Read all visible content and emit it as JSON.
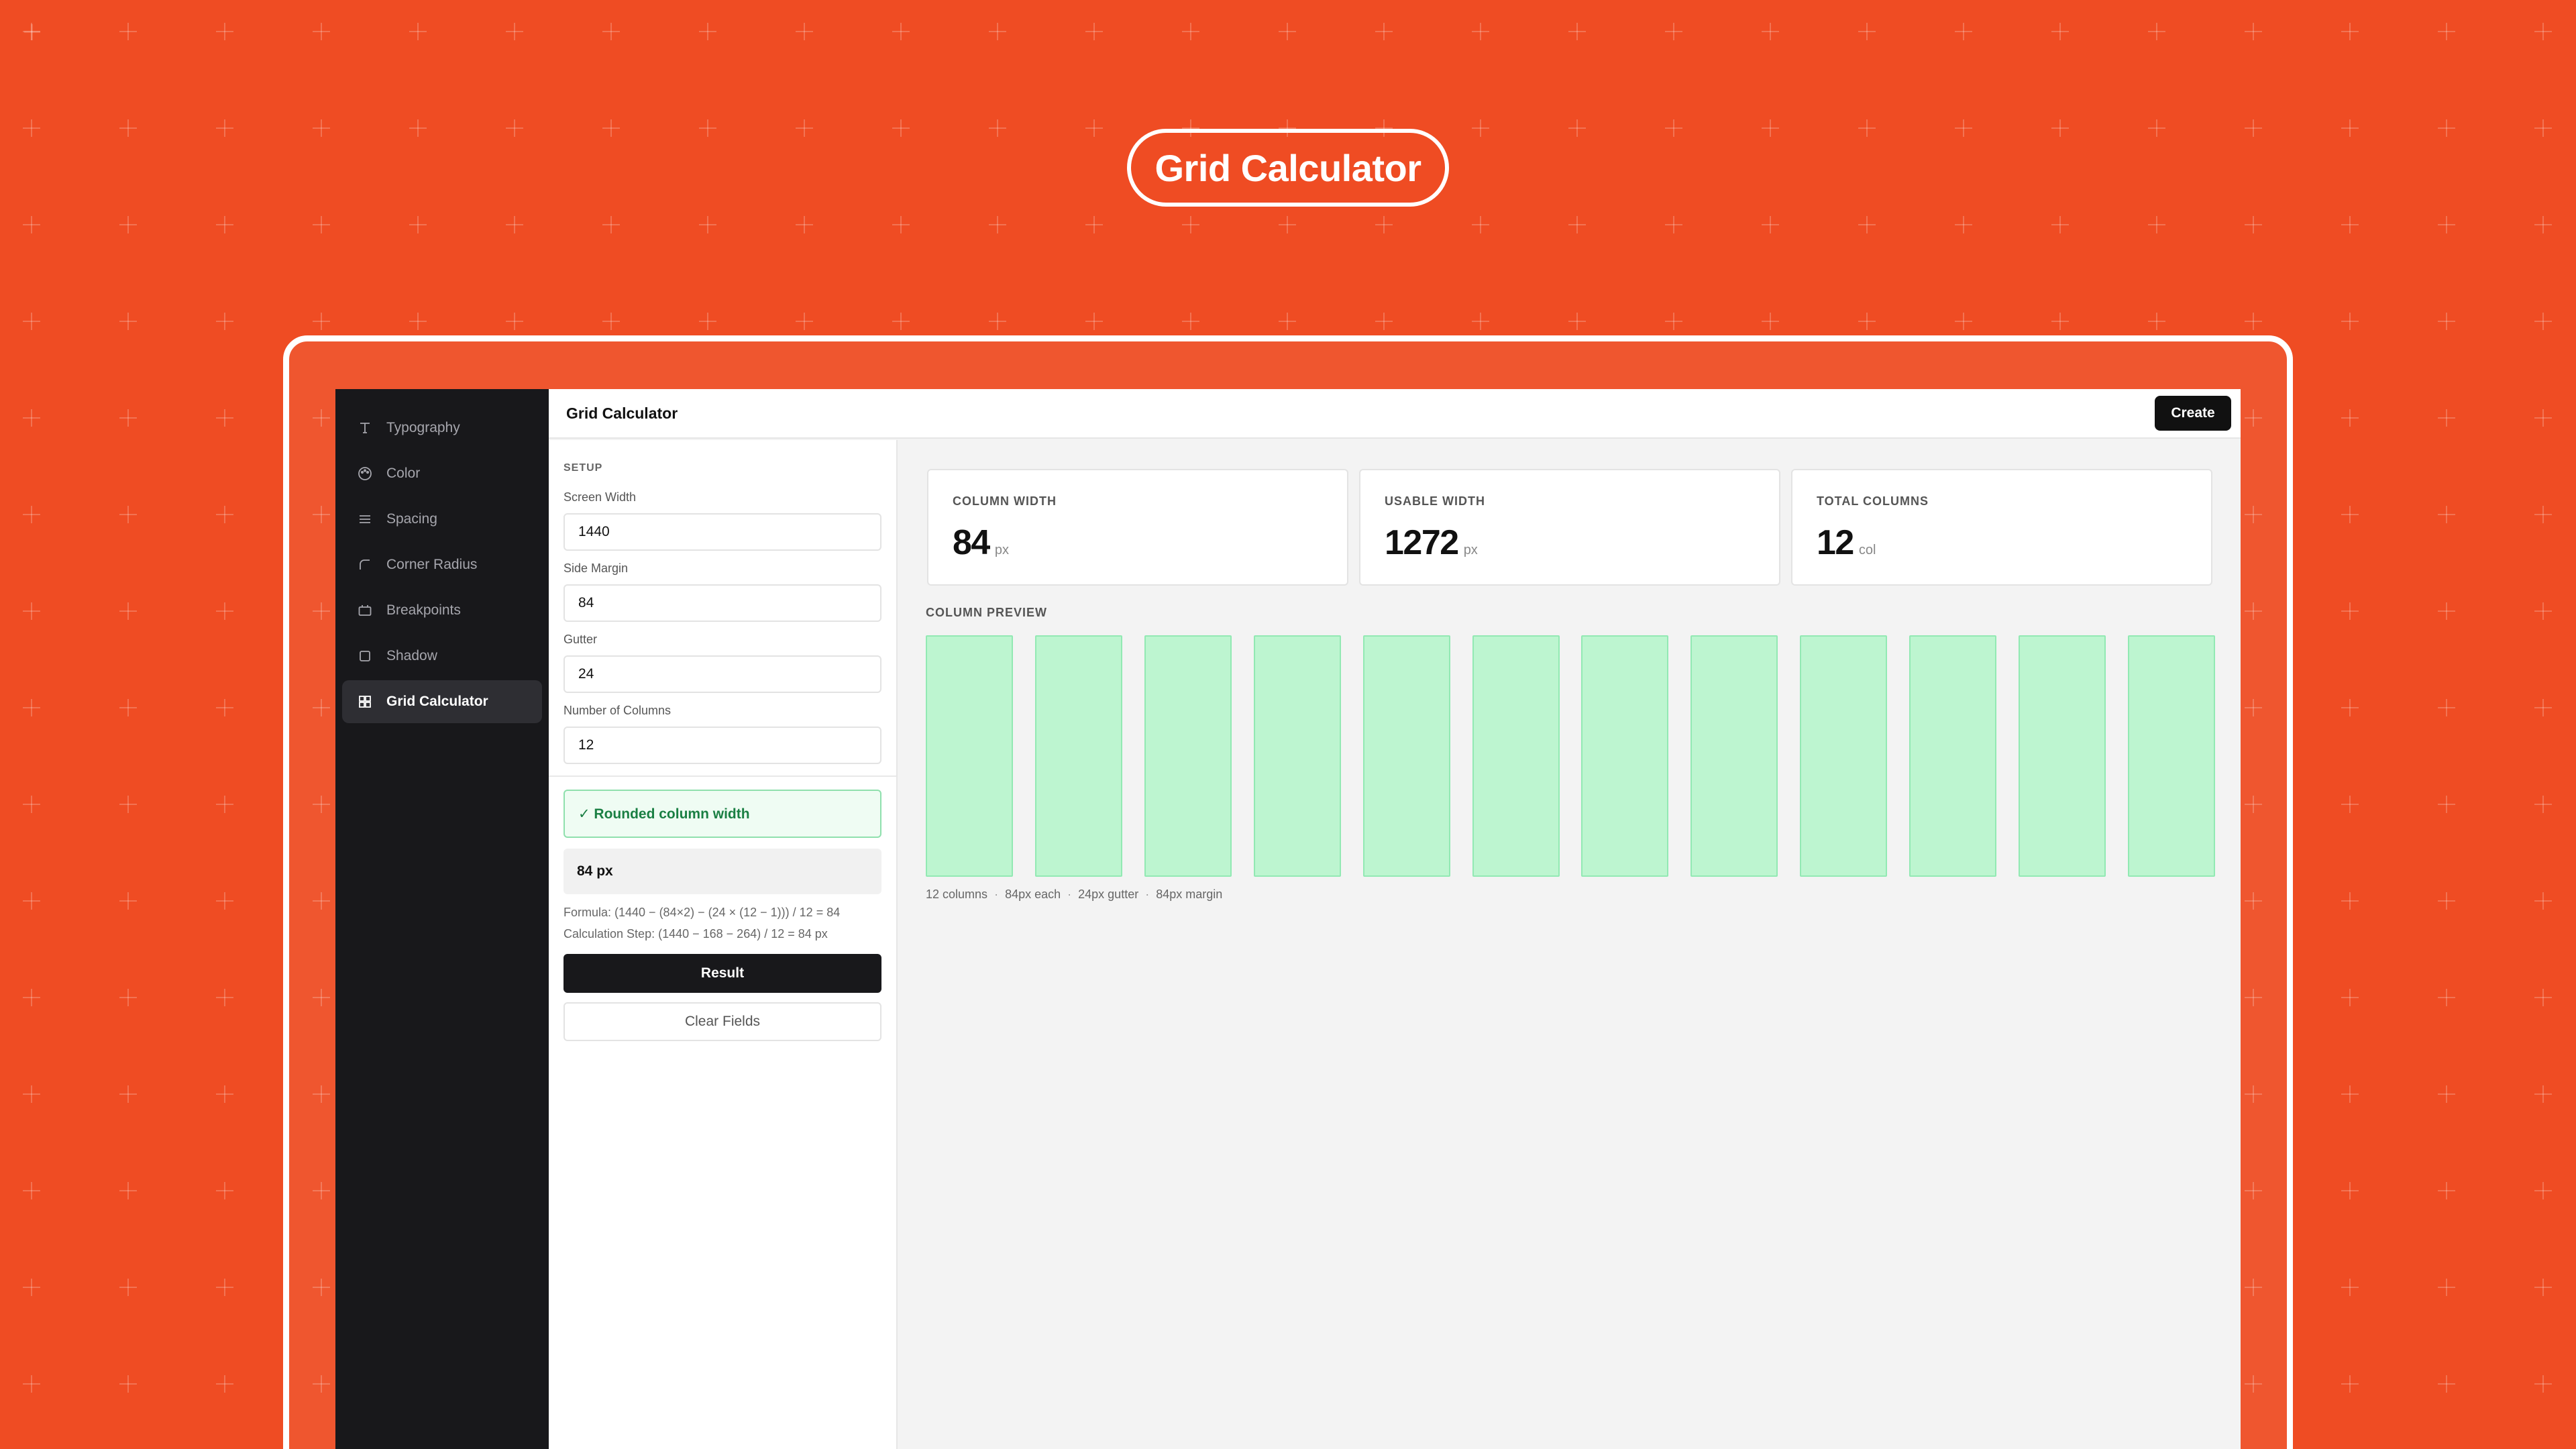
{
  "hero": {
    "title": "Grid Calculator"
  },
  "sidebar": {
    "items": [
      {
        "label": "Typography",
        "icon": "type-icon",
        "active": false
      },
      {
        "label": "Color",
        "icon": "palette-icon",
        "active": false
      },
      {
        "label": "Spacing",
        "icon": "lines-icon",
        "active": false
      },
      {
        "label": "Corner Radius",
        "icon": "corner-radius-icon",
        "active": false
      },
      {
        "label": "Breakpoints",
        "icon": "monitor-icon",
        "active": false
      },
      {
        "label": "Shadow",
        "icon": "square-icon",
        "active": false
      },
      {
        "label": "Grid Calculator",
        "icon": "grid-icon",
        "active": true
      }
    ]
  },
  "topbar": {
    "title": "Grid Calculator",
    "create_label": "Create"
  },
  "form": {
    "section_label": "SETUP",
    "screen_width": {
      "label": "Screen Width",
      "value": "1440"
    },
    "side_margin": {
      "label": "Side Margin",
      "value": "84"
    },
    "gutter": {
      "label": "Gutter",
      "value": "24"
    },
    "columns": {
      "label": "Number of Columns",
      "value": "12"
    },
    "success_message": "✓ Rounded column width",
    "result_value": "84 px",
    "formula": "Formula: (1440 − (84×2) − (24 × (12 − 1))) / 12 = 84",
    "calculation_step": "Calculation Step: (1440 − 168 − 264) / 12 = 84 px",
    "result_label": "Result",
    "clear_label": "Clear Fields"
  },
  "stats": [
    {
      "label": "COLUMN WIDTH",
      "value": "84",
      "unit": "px"
    },
    {
      "label": "USABLE WIDTH",
      "value": "1272",
      "unit": "px"
    },
    {
      "label": "TOTAL COLUMNS",
      "value": "12",
      "unit": "col"
    }
  ],
  "preview": {
    "label": "COLUMN PREVIEW",
    "column_count": 12,
    "meta": [
      "12 columns",
      "84px each",
      "24px gutter",
      "84px margin"
    ]
  },
  "colors": {
    "background": "#ef4c23",
    "sidebar": "#18181b",
    "column_fill": "#bdf5d0",
    "success": "#1a7f43"
  }
}
